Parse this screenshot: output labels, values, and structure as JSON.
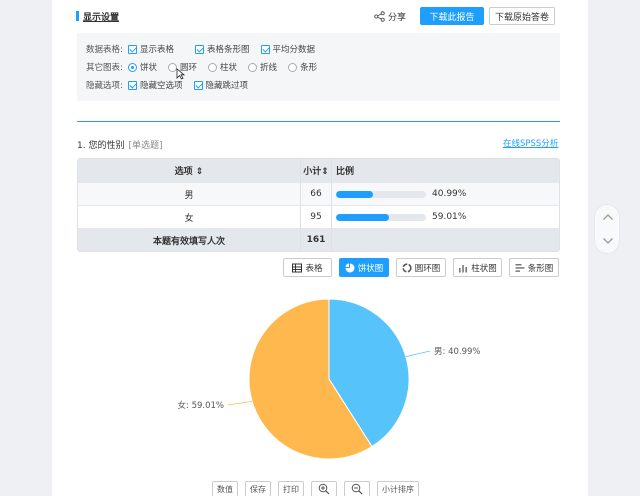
{
  "header": {
    "title": "显示设置",
    "share_label": "分享",
    "download_report_label": "下载此报告",
    "download_answers_label": "下载原始答卷"
  },
  "settings": {
    "row1": {
      "label": "数据表格:",
      "options": [
        "显示表格",
        "表格条形图",
        "平均分数据"
      ]
    },
    "row2": {
      "label": "其它图表:",
      "options": [
        "饼状",
        "圆环",
        "柱状",
        "折线",
        "条形"
      ],
      "selected": "饼状"
    },
    "row3": {
      "label": "隐藏选项:",
      "options": [
        "隐藏空选项",
        "隐藏跳过项"
      ]
    }
  },
  "question": {
    "title": "1. 您的性别",
    "type_tag": "[单选题]",
    "spss_link": "在线SPSS分析"
  },
  "table": {
    "headers": [
      "选项 ⇕",
      "小计⇕",
      "比例"
    ],
    "rows": [
      {
        "option": "男",
        "count": "66",
        "percent_label": "40.99%",
        "percent": 40.99
      },
      {
        "option": "女",
        "count": "95",
        "percent_label": "59.01%",
        "percent": 59.01
      }
    ],
    "footer": {
      "label": "本题有效填写人次",
      "count": "161"
    }
  },
  "chart_buttons": [
    "表格",
    "饼状图",
    "圆环图",
    "柱状图",
    "条形图"
  ],
  "active_chart_button": "饼状图",
  "chart_data": {
    "type": "pie",
    "labels": [
      "男",
      "女"
    ],
    "values": [
      40.99,
      59.01
    ],
    "slice_labels": [
      "男: 40.99%",
      "女: 59.01%"
    ],
    "colors": [
      "#56c3fb",
      "#ffb84d"
    ]
  },
  "tools": [
    "数值",
    "保存",
    "打印",
    "zoom-in",
    "zoom-out",
    "小计排序"
  ],
  "colors": {
    "accent": "#1e9fff",
    "pie_male": "#56c3fb",
    "pie_female": "#ffb84d"
  }
}
